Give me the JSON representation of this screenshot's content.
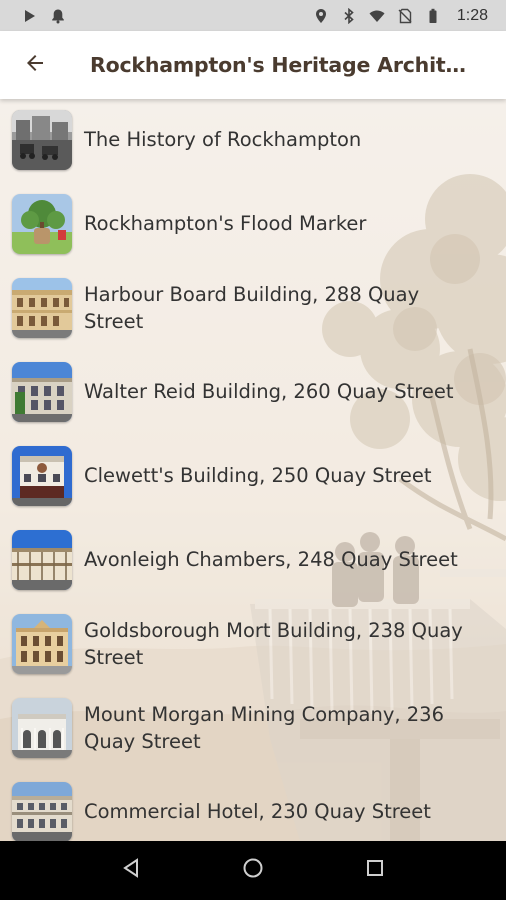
{
  "status_bar": {
    "time": "1:28",
    "icons": [
      "play-icon",
      "notification-icon",
      "location-icon",
      "bluetooth-icon",
      "wifi-icon",
      "no-sim-icon",
      "battery-icon"
    ]
  },
  "app_bar": {
    "back_icon": "arrow-left-icon",
    "title": "Rockhampton's Heritage Architect..."
  },
  "list": {
    "items": [
      {
        "label": "The History of Rockhampton",
        "thumb": "historic-street-photo"
      },
      {
        "label": "Rockhampton's Flood Marker",
        "thumb": "flood-marker-park"
      },
      {
        "label": "Harbour Board Building, 288 Quay Street",
        "thumb": "harbour-board-building"
      },
      {
        "label": "Walter Reid Building, 260 Quay Street",
        "thumb": "walter-reid-building"
      },
      {
        "label": "Clewett's Building, 250 Quay Street",
        "thumb": "clewetts-building"
      },
      {
        "label": "Avonleigh Chambers, 248 Quay Street",
        "thumb": "avonleigh-chambers"
      },
      {
        "label": "Goldsborough Mort Building, 238 Quay Street",
        "thumb": "goldsborough-mort-building"
      },
      {
        "label": "Mount Morgan Mining Company, 236 Quay Street",
        "thumb": "mount-morgan-mining-building"
      },
      {
        "label": "Commercial Hotel, 230 Quay Street",
        "thumb": "commercial-hotel"
      }
    ]
  },
  "nav_bar": {
    "buttons": [
      "back-triangle-icon",
      "home-circle-icon",
      "recents-square-icon"
    ]
  },
  "colors": {
    "title_text": "#4a3b2f",
    "list_text": "#333333",
    "status_bar_bg": "#d9d9d9",
    "nav_bar_bg": "#000000"
  }
}
